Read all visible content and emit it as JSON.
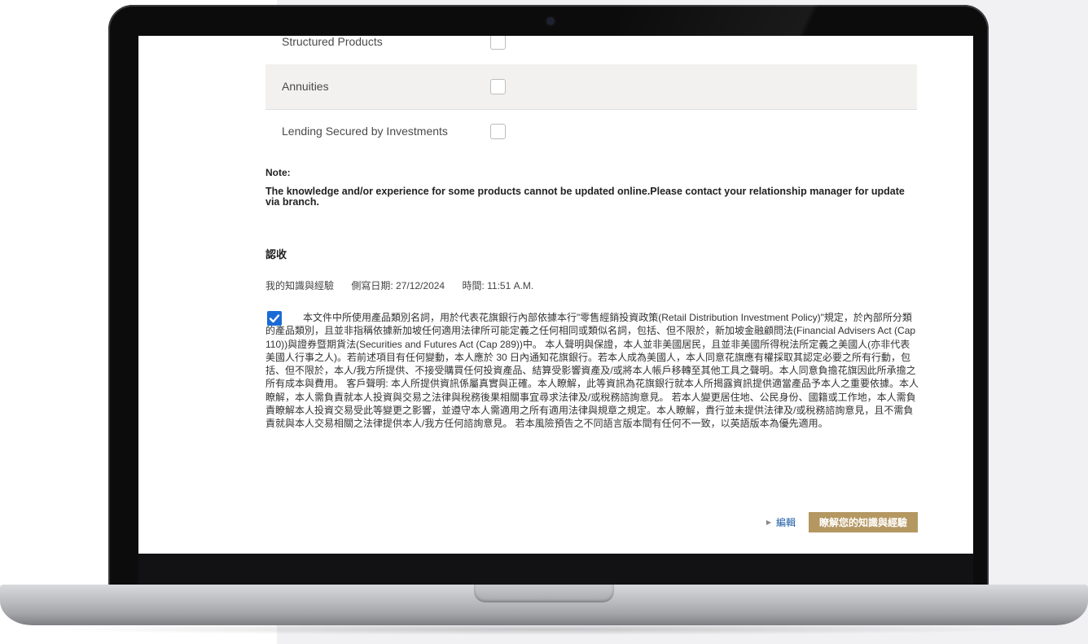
{
  "products": [
    {
      "label": "Structured Products",
      "checked": false
    },
    {
      "label": "Annuities",
      "checked": false
    },
    {
      "label": "Lending Secured by Investments",
      "checked": false
    }
  ],
  "note": {
    "title": "Note:",
    "text": "The knowledge and/or experience for some products cannot be updated online.Please contact your relationship manager for update via branch."
  },
  "acknowledgement": {
    "title": "認收",
    "section": "我的知識與經驗",
    "date": "側寫日期: 27/12/2024",
    "time": "時間: 11:51 A.M.",
    "checked": true,
    "disclaimer": "本文件中所使用產品類別名詞，用於代表花旗銀行內部依據本行\"零售經銷投資政策(Retail Distribution Investment Policy)\"規定，於內部所分類的產品類別，且並非指稱依據新加坡任何適用法律所可能定義之任何相同或類似名詞，包括、但不限於，新加坡金融顧問法(Financial Advisers Act (Cap 110))與證券暨期貨法(Securities and Futures Act (Cap 289))中。 本人聲明與保證，本人並非美國居民，且並非美國所得稅法所定義之美國人(亦非代表美國人行事之人)。若前述項目有任何變動，本人應於 30 日內通知花旗銀行。若本人成為美國人，本人同意花旗應有權採取其認定必要之所有行動，包括、但不限於，本人/我方所提供、不接受購買任何投資產品、結算受影響資產及/或將本人帳戶移轉至其他工具之聲明。本人同意負擔花旗因此所承擔之所有成本與費用。 客戶聲明: 本人所提供資訊係屬真實與正確。本人瞭解，此等資訊為花旗銀行就本人所揭露資訊提供適當產品予本人之重要依據。本人瞭解，本人需負責就本人投資與交易之法律與稅務後果相關事宜尋求法律及/或稅務諮詢意見。 若本人變更居住地、公民身份、國籍或工作地，本人需負責瞭解本人投資交易受此等變更之影響，並遵守本人需適用之所有適用法律與規章之規定。本人瞭解，貴行並未提供法律及/或稅務諮詢意見，且不需負責就與本人交易相關之法律提供本人/我方任何諮詢意見。 若本風險預告之不同語言版本間有任何不一致，以英語版本為優先適用。"
  },
  "actions": {
    "edit_label": "編輯",
    "confirm_label": "瞭解您的知識與經驗"
  },
  "colors": {
    "accent": "#b49761",
    "checkbox_checked": "#1a6ad6",
    "link": "#1a5aa5"
  }
}
